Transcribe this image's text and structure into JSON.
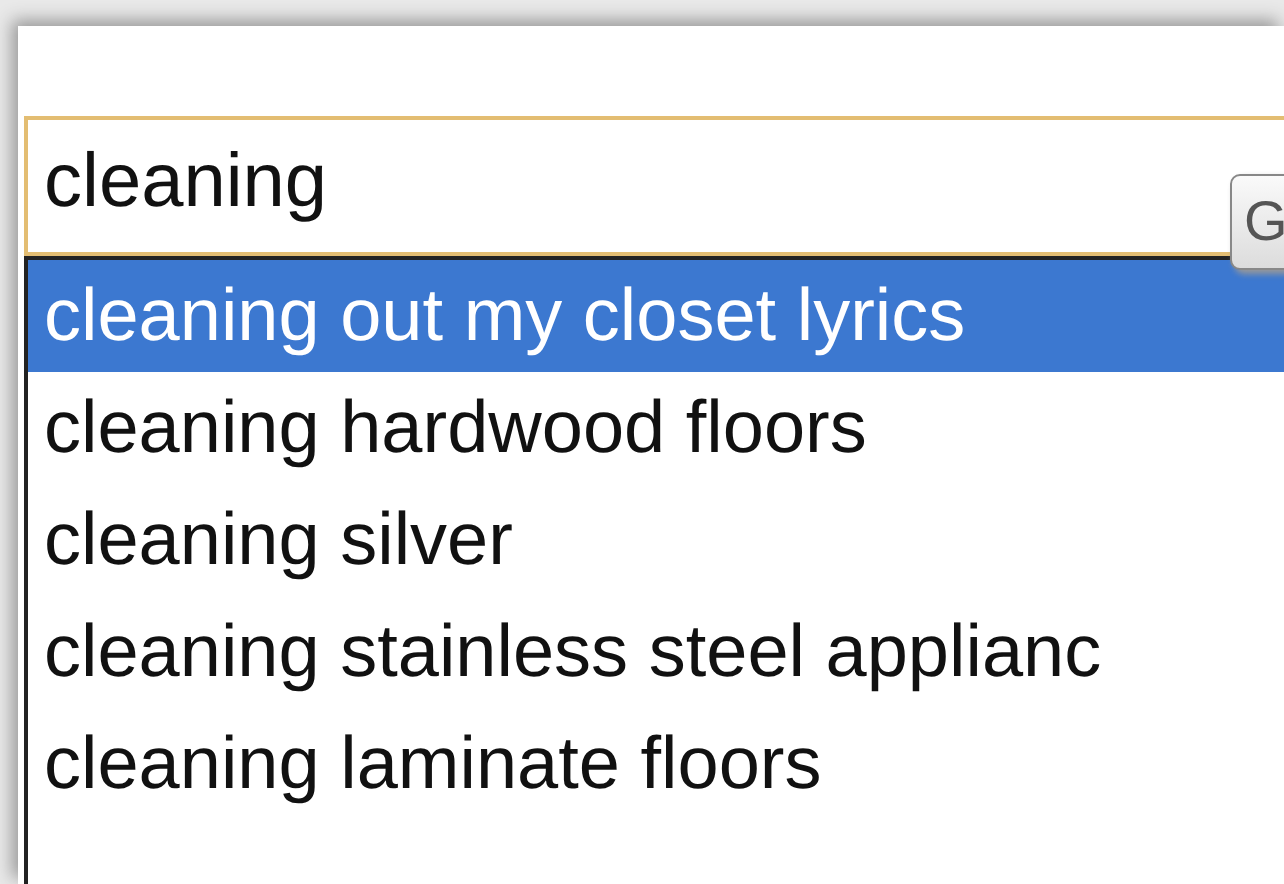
{
  "search": {
    "value": "cleaning"
  },
  "button": {
    "label": "G"
  },
  "suggestions": [
    {
      "text": "cleaning out my closet lyrics",
      "selected": true
    },
    {
      "text": "cleaning hardwood floors",
      "selected": false
    },
    {
      "text": "cleaning silver",
      "selected": false
    },
    {
      "text": "cleaning stainless steel applianc",
      "selected": false
    },
    {
      "text": "cleaning laminate floors",
      "selected": false
    }
  ]
}
